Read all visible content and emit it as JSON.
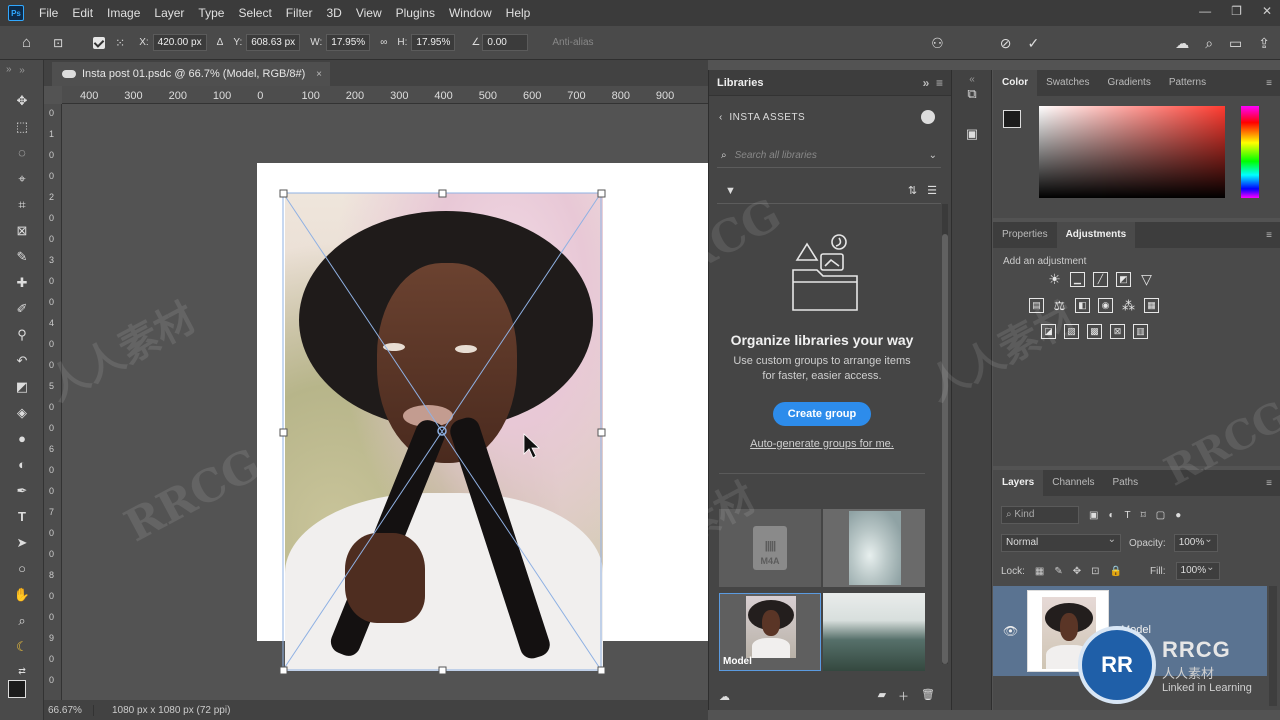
{
  "app": {
    "logo": "Ps",
    "menu": [
      "File",
      "Edit",
      "Image",
      "Layer",
      "Type",
      "Select",
      "Filter",
      "3D",
      "View",
      "Plugins",
      "Window",
      "Help"
    ],
    "window_controls": [
      "—",
      "❐",
      "✕"
    ]
  },
  "options_bar": {
    "x_label": "X:",
    "x_value": "420.00 px",
    "y_label": "Y:",
    "y_value": "608.63 px",
    "w_label": "W:",
    "w_value": "17.95%",
    "h_label": "H:",
    "h_value": "17.95%",
    "angle_value": "0.00",
    "antialias": "Anti-alias"
  },
  "document": {
    "tab_title": "Insta post 01.psdc @ 66.7% (Model, RGB/8#)",
    "close": "×"
  },
  "rulers": {
    "h_ticks": [
      "400",
      "300",
      "200",
      "100",
      "0",
      "100",
      "200",
      "300",
      "400",
      "500",
      "600",
      "700",
      "800",
      "900"
    ],
    "v_ticks": [
      "0",
      "1",
      "0",
      "0",
      "2",
      "0",
      "0",
      "3",
      "0",
      "0",
      "4",
      "0",
      "0",
      "5",
      "0",
      "0",
      "6",
      "0",
      "0",
      "7",
      "0",
      "0",
      "8",
      "0",
      "0",
      "9",
      "0",
      "0"
    ]
  },
  "libraries": {
    "panel_title": "Libraries",
    "library_name": "INSTA ASSETS",
    "search_placeholder": "Search all libraries",
    "empty_title": "Organize libraries your way",
    "empty_desc": "Use custom groups to arrange items for faster, easier access.",
    "create_group": "Create group",
    "auto_generate": "Auto-generate groups for me.",
    "assets": [
      {
        "label": "M4A",
        "type": "audio"
      },
      {
        "label": "",
        "type": "image"
      },
      {
        "label": "Model",
        "type": "image"
      },
      {
        "label": "",
        "type": "image"
      }
    ]
  },
  "color_panel": {
    "tabs": [
      "Color",
      "Swatches",
      "Gradients",
      "Patterns"
    ],
    "active_tab": "Color",
    "foreground": "#1c1c1c",
    "background": "#f3f3f3",
    "hue": "#ff3b30"
  },
  "adjustments_panel": {
    "tabs": [
      "Properties",
      "Adjustments"
    ],
    "active_tab": "Adjustments",
    "hint": "Add an adjustment"
  },
  "layers_panel": {
    "tabs": [
      "Layers",
      "Channels",
      "Paths"
    ],
    "active_tab": "Layers",
    "kind_placeholder": "Kind",
    "blend_mode": "Normal",
    "opacity_label": "Opacity:",
    "opacity_value": "100%",
    "lock_label": "Lock:",
    "fill_label": "Fill:",
    "fill_value": "100%",
    "layer_name": "Model"
  },
  "statusbar": {
    "zoom": "66.67%",
    "dimensions": "1080 px x 1080 px (72 ppi)"
  },
  "watermark": {
    "text": "RRCG",
    "text_cn": "人人素材",
    "brand_top": "RRCG",
    "brand_bottom": "人人素材",
    "linkedin": "Linked in Learning"
  }
}
